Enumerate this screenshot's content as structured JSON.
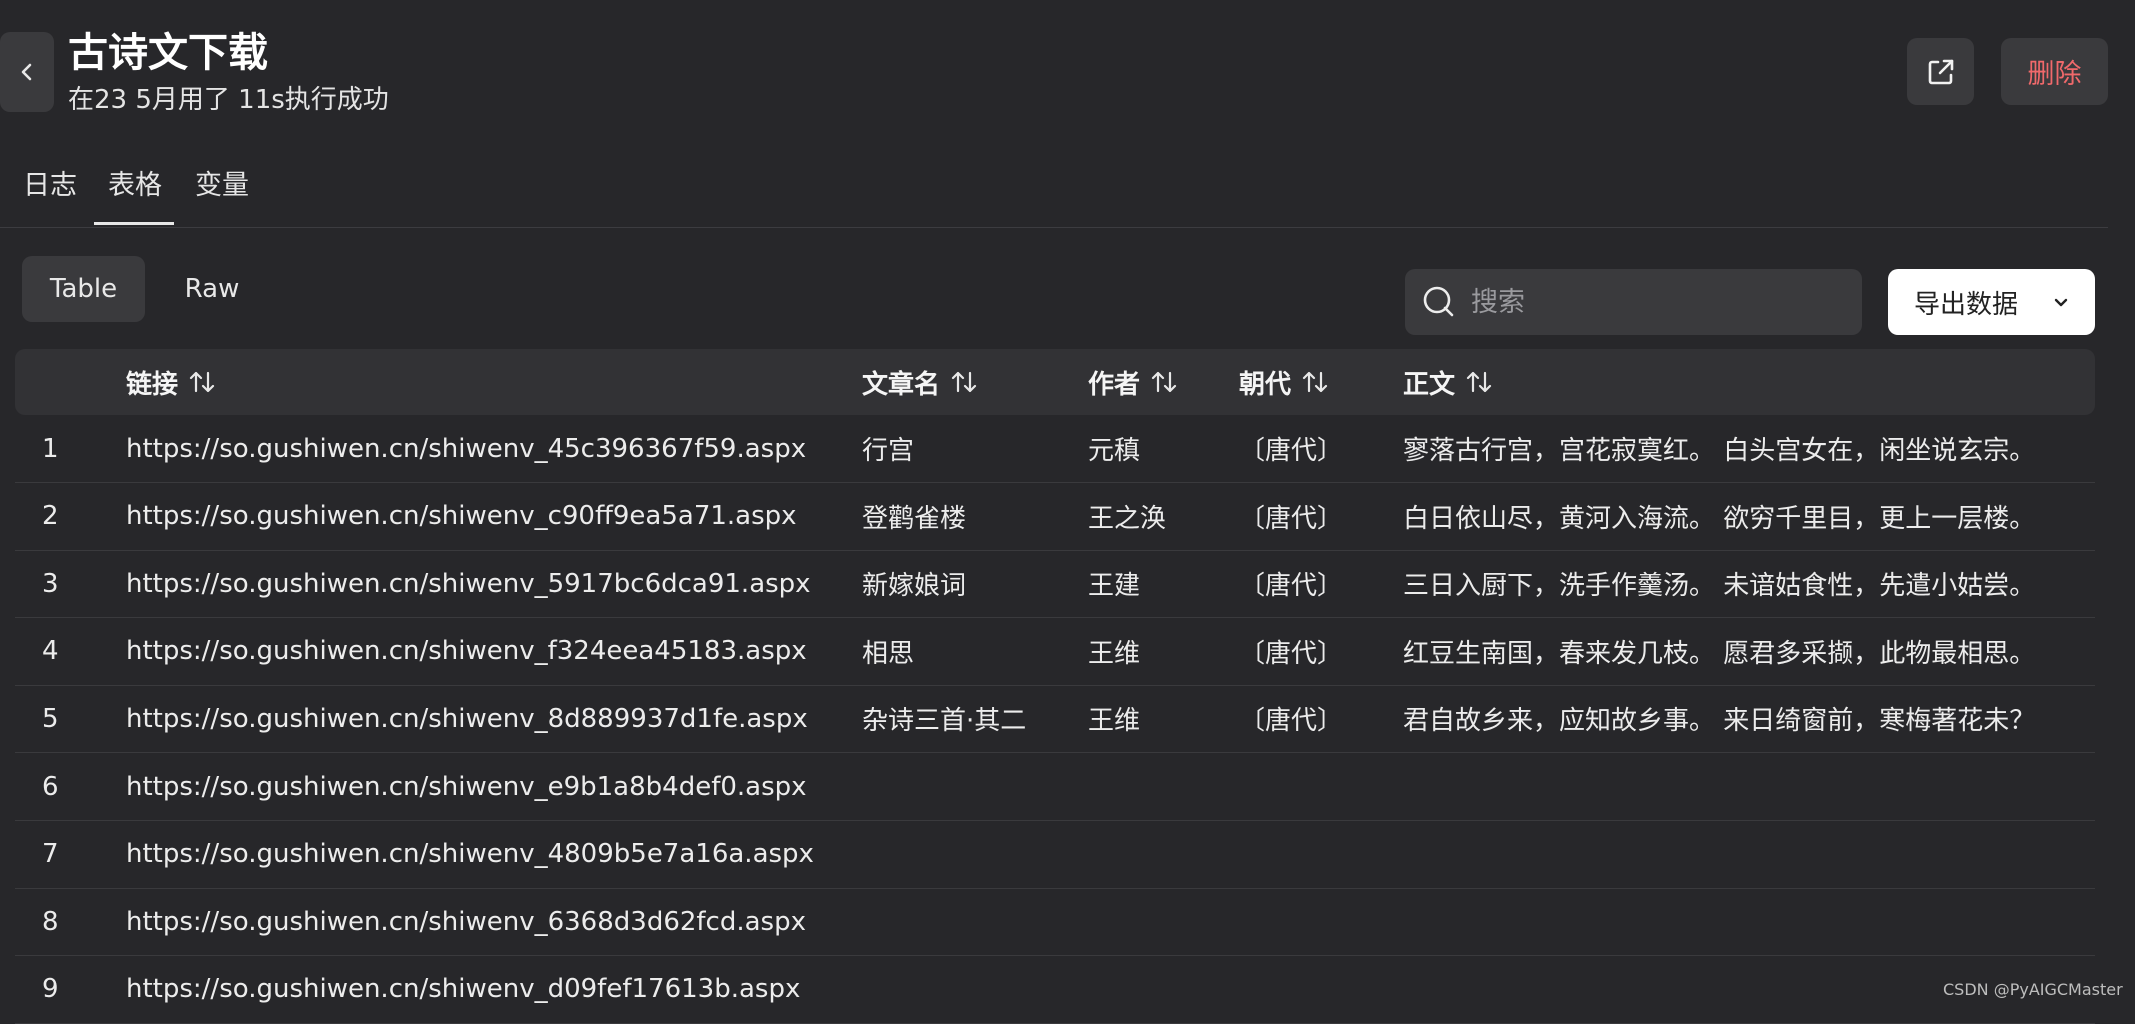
{
  "header": {
    "title": "古诗文下载",
    "subtitle": "在23 5月用了 11s执行成功",
    "delete_label": "删除"
  },
  "tabs": [
    {
      "label": "日志",
      "active": false
    },
    {
      "label": "表格",
      "active": true
    },
    {
      "label": "变量",
      "active": false
    }
  ],
  "view_toggle": {
    "table_label": "Table",
    "raw_label": "Raw",
    "selected": "Table"
  },
  "search": {
    "placeholder": "搜索",
    "value": ""
  },
  "export": {
    "label": "导出数据"
  },
  "table": {
    "columns": [
      "链接",
      "文章名",
      "作者",
      "朝代",
      "正文"
    ],
    "rows": [
      {
        "index": "1",
        "link": "https://so.gushiwen.cn/shiwenv_45c396367f59.aspx",
        "name": "行宫",
        "author": "元稹",
        "dynasty": "〔唐代〕",
        "text": "寥落古行宫，宫花寂寞红。 白头宫女在，闲坐说玄宗。"
      },
      {
        "index": "2",
        "link": "https://so.gushiwen.cn/shiwenv_c90ff9ea5a71.aspx",
        "name": "登鹳雀楼",
        "author": "王之涣",
        "dynasty": "〔唐代〕",
        "text": "白日依山尽，黄河入海流。 欲穷千里目，更上一层楼。"
      },
      {
        "index": "3",
        "link": "https://so.gushiwen.cn/shiwenv_5917bc6dca91.aspx",
        "name": "新嫁娘词",
        "author": "王建",
        "dynasty": "〔唐代〕",
        "text": "三日入厨下，洗手作羹汤。 未谙姑食性，先遣小姑尝。"
      },
      {
        "index": "4",
        "link": "https://so.gushiwen.cn/shiwenv_f324eea45183.aspx",
        "name": "相思",
        "author": "王维",
        "dynasty": "〔唐代〕",
        "text": "红豆生南国，春来发几枝。 愿君多采撷，此物最相思。"
      },
      {
        "index": "5",
        "link": "https://so.gushiwen.cn/shiwenv_8d889937d1fe.aspx",
        "name": "杂诗三首·其二",
        "author": "王维",
        "dynasty": "〔唐代〕",
        "text": "君自故乡来，应知故乡事。 来日绮窗前，寒梅著花未？"
      },
      {
        "index": "6",
        "link": "https://so.gushiwen.cn/shiwenv_e9b1a8b4def0.aspx",
        "name": "",
        "author": "",
        "dynasty": "",
        "text": ""
      },
      {
        "index": "7",
        "link": "https://so.gushiwen.cn/shiwenv_4809b5e7a16a.aspx",
        "name": "",
        "author": "",
        "dynasty": "",
        "text": ""
      },
      {
        "index": "8",
        "link": "https://so.gushiwen.cn/shiwenv_6368d3d62fcd.aspx",
        "name": "",
        "author": "",
        "dynasty": "",
        "text": ""
      },
      {
        "index": "9",
        "link": "https://so.gushiwen.cn/shiwenv_d09fef17613b.aspx",
        "name": "",
        "author": "",
        "dynasty": "",
        "text": ""
      }
    ]
  },
  "watermark": "CSDN @PyAIGCMaster",
  "colors": {
    "background": "#27272a",
    "surface": "#3a3a3d",
    "header_row": "#323235",
    "danger": "#f0696b",
    "export_bg": "#ffffff"
  },
  "icons": {
    "back": "chevron-left-icon",
    "open": "external-link-icon",
    "search": "search-icon",
    "sort": "sort-arrows-icon",
    "dropdown": "chevron-down-icon"
  }
}
